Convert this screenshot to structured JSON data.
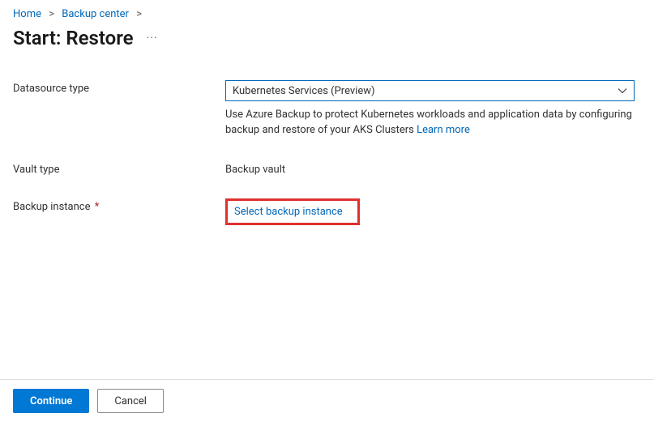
{
  "breadcrumb": {
    "items": [
      {
        "label": "Home"
      },
      {
        "label": "Backup center"
      }
    ],
    "sep": ">"
  },
  "pageTitle": "Start: Restore",
  "moreDots": "···",
  "form": {
    "datasourceType": {
      "label": "Datasource type",
      "value": "Kubernetes Services (Preview)",
      "helperPrefix": "Use Azure Backup to protect Kubernetes workloads and application data by configuring backup and restore of your AKS Clusters ",
      "learnMore": "Learn more"
    },
    "vaultType": {
      "label": "Vault type",
      "value": "Backup vault"
    },
    "backupInstance": {
      "label": "Backup instance",
      "required": "*",
      "linkText": "Select backup instance"
    }
  },
  "footer": {
    "continue": "Continue",
    "cancel": "Cancel"
  }
}
